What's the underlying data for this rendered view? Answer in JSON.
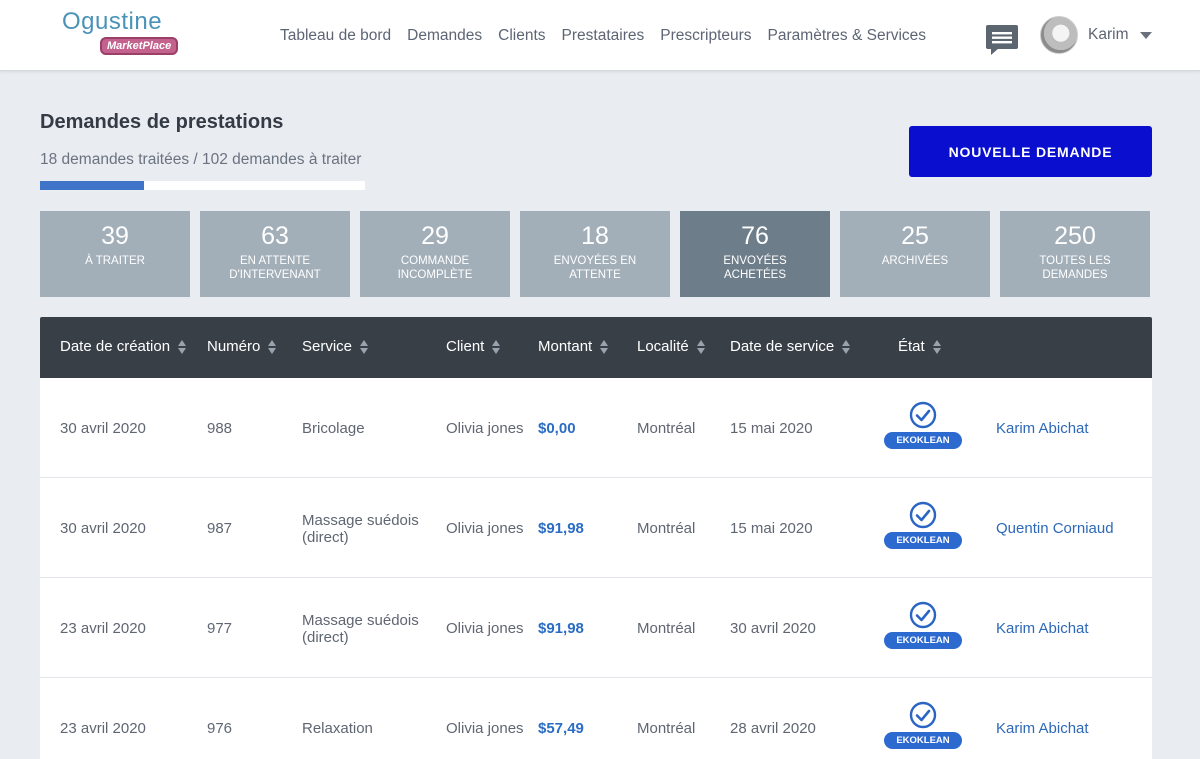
{
  "logo": {
    "word": "Ogustine",
    "badge": "MarketPlace"
  },
  "nav": [
    "Tableau de bord",
    "Demandes",
    "Clients",
    "Prestataires",
    "Prescripteurs",
    "Paramètres & Services"
  ],
  "user": {
    "name": "Karim"
  },
  "page": {
    "title": "Demandes de prestations",
    "subtitle": "18 demandes traitées / 102 demandes à traiter",
    "progress": 0.32,
    "new_button": "NOUVELLE DEMANDE"
  },
  "tiles": [
    {
      "count": "39",
      "label": "À TRAITER"
    },
    {
      "count": "63",
      "label": "EN ATTENTE D'INTERVENANT"
    },
    {
      "count": "29",
      "label": "COMMANDE INCOMPLÈTE"
    },
    {
      "count": "18",
      "label": "ENVOYÉES EN ATTENTE"
    },
    {
      "count": "76",
      "label": "ENVOYÉES ACHETÉES",
      "active": true
    },
    {
      "count": "25",
      "label": "ARCHIVÉES"
    },
    {
      "count": "250",
      "label": "TOUTES LES DEMANDES"
    }
  ],
  "table": {
    "columns": [
      "Date de création",
      "Numéro",
      "Service",
      "Client",
      "Montant",
      "Localité",
      "Date de service",
      "État"
    ],
    "rows": [
      {
        "created": "30 avril 2020",
        "number": "988",
        "service": "Bricolage",
        "client": "Olivia jones",
        "amount": "$0,00",
        "locality": "Montréal",
        "service_date": "15 mai 2020",
        "state_badge": "EKOKLEAN",
        "provider": "Karim Abichat"
      },
      {
        "created": "30 avril 2020",
        "number": "987",
        "service": "Massage suédois (direct)",
        "client": "Olivia jones",
        "amount": "$91,98",
        "locality": "Montréal",
        "service_date": "15 mai 2020",
        "state_badge": "EKOKLEAN",
        "provider": "Quentin Corniaud"
      },
      {
        "created": "23 avril 2020",
        "number": "977",
        "service": "Massage suédois (direct)",
        "client": "Olivia jones",
        "amount": "$91,98",
        "locality": "Montréal",
        "service_date": "30 avril 2020",
        "state_badge": "EKOKLEAN",
        "provider": "Karim Abichat"
      },
      {
        "created": "23 avril 2020",
        "number": "976",
        "service": "Relaxation",
        "client": "Olivia jones",
        "amount": "$57,49",
        "locality": "Montréal",
        "service_date": "28 avril 2020",
        "state_badge": "EKOKLEAN",
        "provider": "Karim Abichat"
      }
    ]
  },
  "icons": {
    "chat": "chat-icon",
    "state": "check-circle-icon",
    "sort": "sort-icon",
    "caret": "caret-down-icon"
  },
  "colors": {
    "primary_button": "#0a0fcf",
    "progress": "#3f74c9",
    "tile": "#a2aeb8",
    "tile_active": "#6d7d8a",
    "table_header": "#383f47",
    "badge": "#2c6ad0"
  }
}
